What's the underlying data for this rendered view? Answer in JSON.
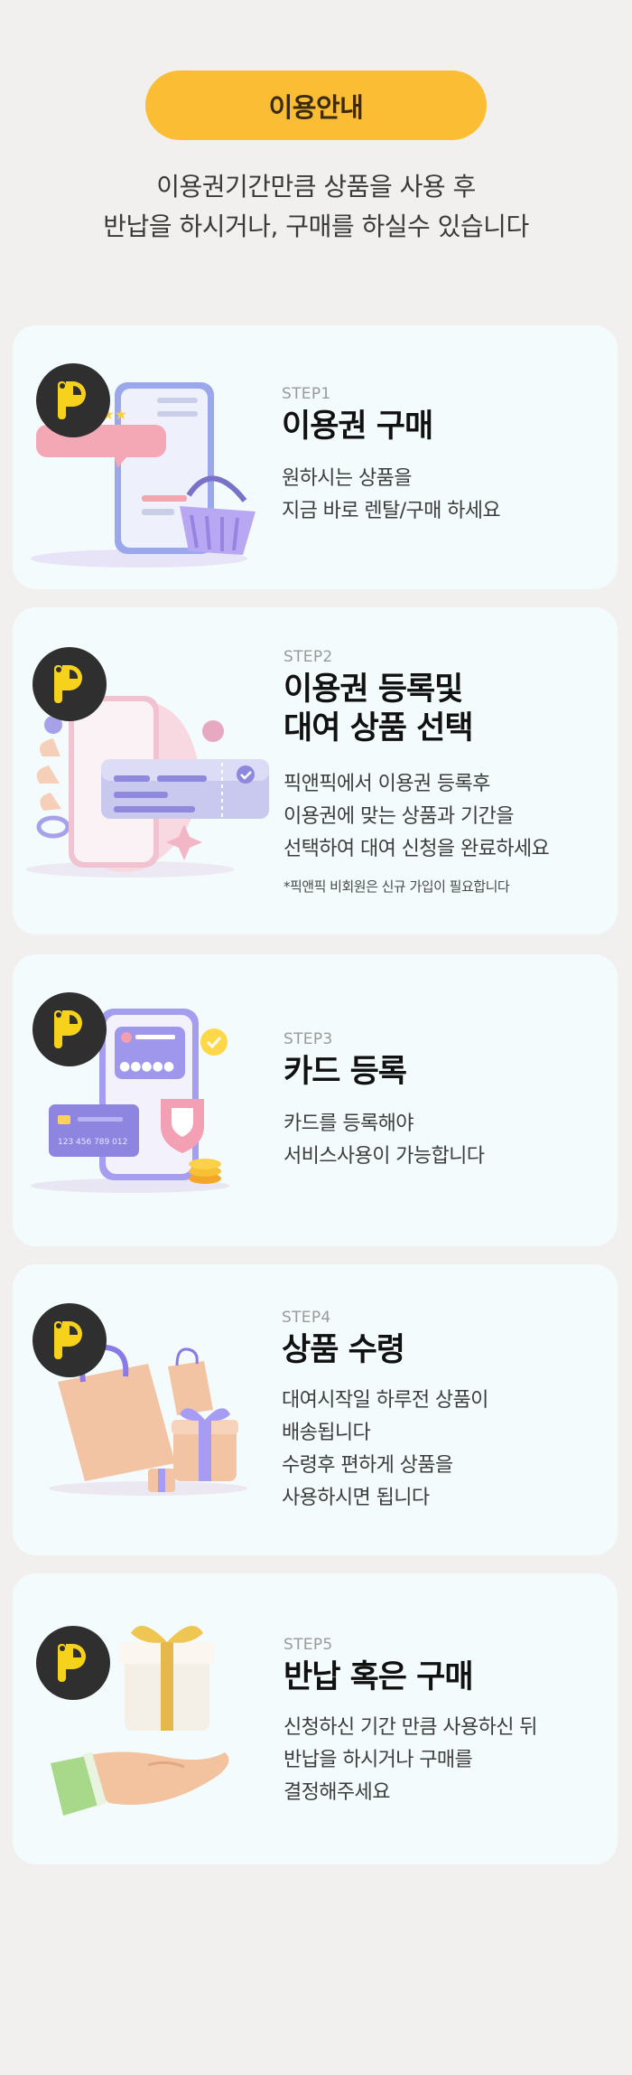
{
  "header": {
    "pill_label": "이용안내",
    "intro_lines": [
      "이용권기간만큼 상품을 사용 후",
      "반납을 하시거나, 구매를 하실수 있습니다"
    ]
  },
  "steps": [
    {
      "step": "STEP1",
      "title_lines": [
        "이용권 구매"
      ],
      "desc_lines": [
        "원하시는 상품을",
        "지금 바로 렌탈/구매 하세요"
      ],
      "note": "",
      "illustration": "phone-rating-basket-icon"
    },
    {
      "step": "STEP2",
      "title_lines": [
        "이용권 등록및",
        "대여 상품 선택"
      ],
      "desc_lines": [
        "픽앤픽에서 이용권 등록후",
        "이용권에 맞는 상품과 기간을",
        "선택하여 대여 신청을 완료하세요"
      ],
      "note": "*픽앤픽 비회원은 신규 가입이 필요합니다",
      "illustration": "hand-phone-ticket-icon"
    },
    {
      "step": "STEP3",
      "title_lines": [
        "카드 등록"
      ],
      "desc_lines": [
        "카드를 등록해야",
        "서비스사용이 가능합니다"
      ],
      "note": "",
      "illustration": "phone-card-shield-icon",
      "card_number": "123 456 789 012"
    },
    {
      "step": "STEP4",
      "title_lines": [
        "상품 수령"
      ],
      "desc_lines": [
        "대여시작일 하루전 상품이",
        "배송됩니다",
        "수령후 편하게 상품을",
        "사용하시면 됩니다"
      ],
      "note": "",
      "illustration": "shopping-bags-gifts-icon"
    },
    {
      "step": "STEP5",
      "title_lines": [
        "반납 혹은 구매"
      ],
      "desc_lines": [
        "신청하신 기간 만큼 사용하신 뒤",
        "반납을 하시거나 구매를",
        "결정해주세요"
      ],
      "note": "",
      "illustration": "hand-gift-box-icon"
    }
  ],
  "colors": {
    "accent": "#fbbd33",
    "card_bg": "#f4fbfc",
    "page_bg": "#f1f0ee",
    "logo_bg": "#2f2f2f",
    "logo_fg": "#f6d21c"
  }
}
